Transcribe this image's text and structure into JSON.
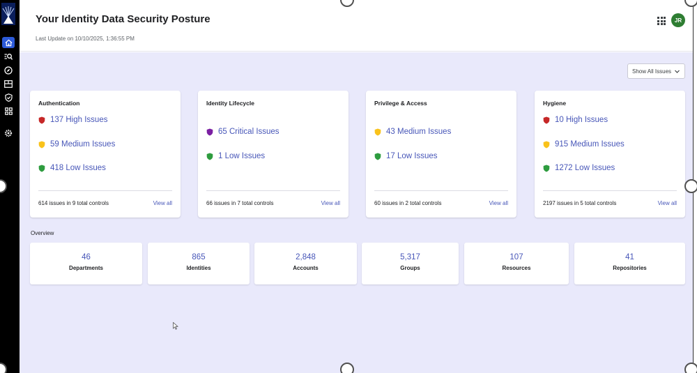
{
  "header": {
    "title": "Your Identity Data Security Posture",
    "last_update": "Last Update on 10/10/2025, 1:36:55 PM",
    "avatar_initials": "JR"
  },
  "sidebar": {
    "items": [
      {
        "icon": "home-icon",
        "active": true
      },
      {
        "icon": "search-list-icon",
        "active": false
      },
      {
        "icon": "compass-icon",
        "active": false
      },
      {
        "icon": "dashboard-icon",
        "active": false
      },
      {
        "icon": "shield-check-icon",
        "active": false
      },
      {
        "icon": "grid-icon",
        "active": false
      },
      {
        "icon": "gear-icon",
        "active": false
      }
    ]
  },
  "filter": {
    "label": "Show All Issues"
  },
  "colors": {
    "high": "#c62828",
    "critical": "#7b1fa2",
    "medium": "#f9c21b",
    "low": "#2e9c3f",
    "link": "#4756b8",
    "background": "#e9e9fb"
  },
  "cards": [
    {
      "title": "Authentication",
      "issues": [
        {
          "label": "137 High Issues",
          "severity": "high"
        },
        {
          "label": "59 Medium Issues",
          "severity": "medium"
        },
        {
          "label": "418 Low Issues",
          "severity": "low"
        }
      ],
      "summary": "614 issues in 9 total controls",
      "view_all": "View all"
    },
    {
      "title": "Identity Lifecycle",
      "issues": [
        {
          "label": "65 Critical Issues",
          "severity": "critical"
        },
        {
          "label": "1 Low Issues",
          "severity": "low"
        }
      ],
      "summary": "66 issues in 7 total controls",
      "view_all": "View all"
    },
    {
      "title": "Privilege & Access",
      "issues": [
        {
          "label": "43 Medium Issues",
          "severity": "medium"
        },
        {
          "label": "17 Low Issues",
          "severity": "low"
        }
      ],
      "summary": "60 issues in 2 total controls",
      "view_all": "View all"
    },
    {
      "title": "Hygiene",
      "issues": [
        {
          "label": "10 High Issues",
          "severity": "high"
        },
        {
          "label": "915 Medium Issues",
          "severity": "medium"
        },
        {
          "label": "1272 Low Issues",
          "severity": "low"
        }
      ],
      "summary": "2197 issues in 5 total controls",
      "view_all": "View all"
    }
  ],
  "overview": {
    "label": "Overview",
    "stats": [
      {
        "value": "46",
        "label": "Departments"
      },
      {
        "value": "865",
        "label": "Identities"
      },
      {
        "value": "2,848",
        "label": "Accounts"
      },
      {
        "value": "5,317",
        "label": "Groups"
      },
      {
        "value": "107",
        "label": "Resources"
      },
      {
        "value": "41",
        "label": "Repositories"
      }
    ]
  }
}
